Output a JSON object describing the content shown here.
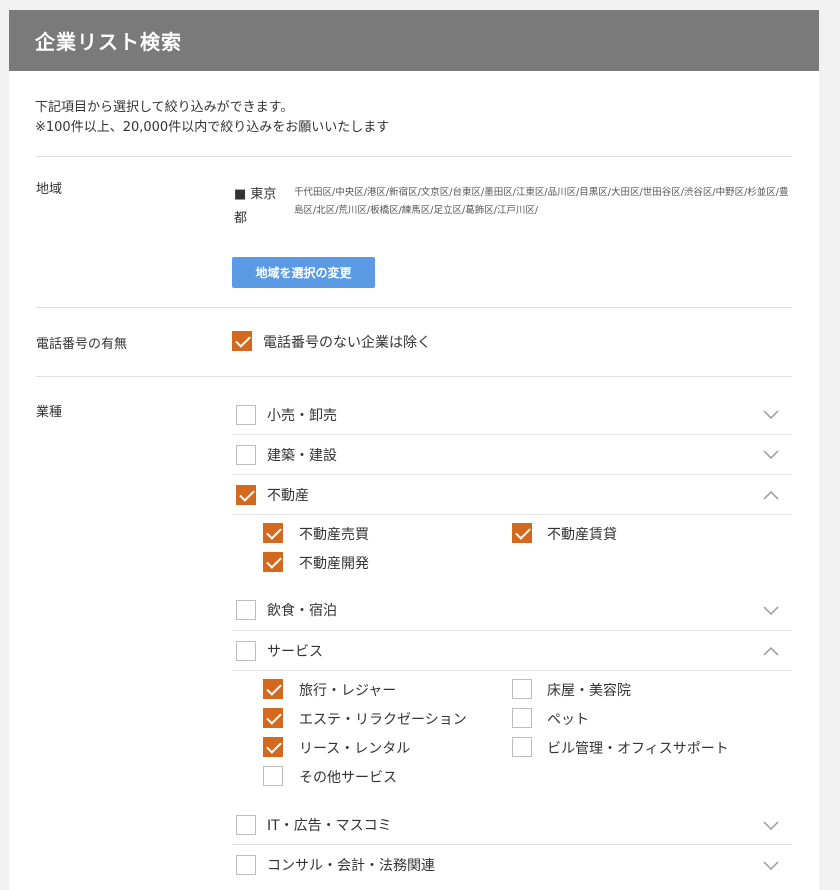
{
  "header": {
    "title": "企業リスト検索"
  },
  "intro": {
    "line1": "下記項目から選択して絞り込みができます。",
    "line2": "※100件以上、20,000件以内で絞り込みをお願いいたします"
  },
  "region": {
    "label": "地域",
    "prefecture": "■ 東京都",
    "areas": "千代田区/中央区/港区/新宿区/文京区/台東区/墨田区/江東区/品川区/目黒区/大田区/世田谷区/渋谷区/中野区/杉並区/豊島区/北区/荒川区/板橋区/練馬区/足立区/葛飾区/江戸川区/",
    "change_button": "地域を選択の変更"
  },
  "phone": {
    "label": "電話番号の有無",
    "option": "電話番号のない企業は除く",
    "checked": true
  },
  "industry": {
    "label": "業種",
    "categories": [
      {
        "label": "小売・卸売",
        "checked": false,
        "expanded": false
      },
      {
        "label": "建築・建設",
        "checked": false,
        "expanded": false
      },
      {
        "label": "不動産",
        "checked": true,
        "expanded": true,
        "subs": [
          {
            "label": "不動産売買",
            "checked": true
          },
          {
            "label": "不動産賃貸",
            "checked": true
          },
          {
            "label": "不動産開発",
            "checked": true
          }
        ]
      },
      {
        "label": "飲食・宿泊",
        "checked": false,
        "expanded": false
      },
      {
        "label": "サービス",
        "checked": false,
        "expanded": true,
        "subs": [
          {
            "label": "旅行・レジャー",
            "checked": true
          },
          {
            "label": "床屋・美容院",
            "checked": false
          },
          {
            "label": "エステ・リラクゼーション",
            "checked": true
          },
          {
            "label": "ペット",
            "checked": false
          },
          {
            "label": "リース・レンタル",
            "checked": true
          },
          {
            "label": "ビル管理・オフィスサポート",
            "checked": false
          },
          {
            "label": "その他サービス",
            "checked": false
          }
        ]
      },
      {
        "label": "IT・広告・マスコミ",
        "checked": false,
        "expanded": false
      },
      {
        "label": "コンサル・会計・法務関連",
        "checked": false,
        "expanded": false
      }
    ]
  },
  "colors": {
    "header_bg": "#7a7a7a",
    "accent": "#d2691e",
    "button": "#5b9be6"
  },
  "icons": {
    "expand": "chevron-down-icon",
    "collapse": "chevron-up-icon",
    "check": "checkmark-icon"
  }
}
